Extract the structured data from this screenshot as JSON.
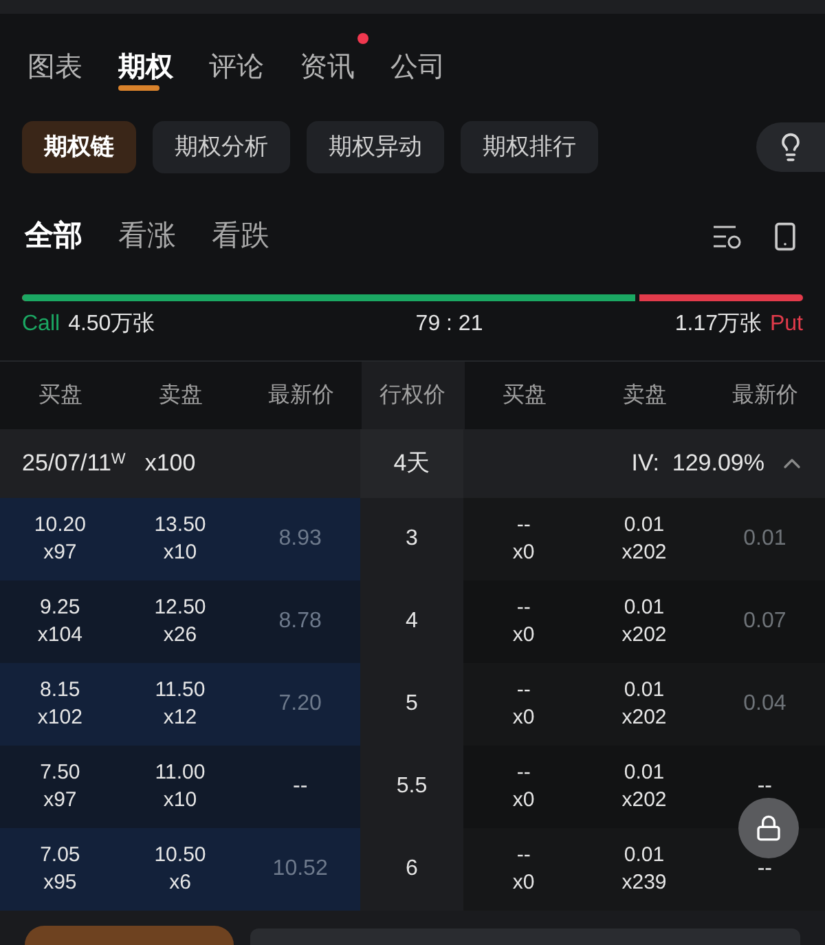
{
  "main_tabs": [
    {
      "label": "图表",
      "selected": false,
      "dot": false
    },
    {
      "label": "期权",
      "selected": true,
      "dot": false
    },
    {
      "label": "评论",
      "selected": false,
      "dot": false
    },
    {
      "label": "资讯",
      "selected": false,
      "dot": true
    },
    {
      "label": "公司",
      "selected": false,
      "dot": false
    }
  ],
  "sub_tabs": [
    {
      "label": "期权链",
      "selected": true
    },
    {
      "label": "期权分析",
      "selected": false
    },
    {
      "label": "期权异动",
      "selected": false
    },
    {
      "label": "期权排行",
      "selected": false
    }
  ],
  "filter_tabs": [
    {
      "label": "全部",
      "selected": true
    },
    {
      "label": "看涨",
      "selected": false
    },
    {
      "label": "看跌",
      "selected": false
    }
  ],
  "ratio": {
    "level": 0.79,
    "call_label": "Call",
    "call_volume": "4.50万张",
    "ratio_text": "79 : 21",
    "put_volume": "1.17万张",
    "put_label": "Put"
  },
  "columns": [
    "买盘",
    "卖盘",
    "最新价",
    "行权价",
    "买盘",
    "卖盘",
    "最新价"
  ],
  "expiry": {
    "date": "25/07/11",
    "date_mark": "W",
    "multiplier": "x100",
    "days": "4天",
    "iv": "IV:  129.09%",
    "expanded": true
  },
  "rows": [
    {
      "call_bid": "10.20",
      "call_bid_size": "x97",
      "call_ask": "13.50",
      "call_ask_size": "x10",
      "call_last": "8.93",
      "call_last_dim": true,
      "strike": "3",
      "put_bid": "--",
      "put_bid_size": "x0",
      "put_ask": "0.01",
      "put_ask_size": "x202",
      "put_last": "0.01",
      "put_last_dim": true
    },
    {
      "call_bid": "9.25",
      "call_bid_size": "x104",
      "call_ask": "12.50",
      "call_ask_size": "x26",
      "call_last": "8.78",
      "call_last_dim": true,
      "strike": "4",
      "put_bid": "--",
      "put_bid_size": "x0",
      "put_ask": "0.01",
      "put_ask_size": "x202",
      "put_last": "0.07",
      "put_last_dim": true
    },
    {
      "call_bid": "8.15",
      "call_bid_size": "x102",
      "call_ask": "11.50",
      "call_ask_size": "x12",
      "call_last": "7.20",
      "call_last_dim": true,
      "strike": "5",
      "put_bid": "--",
      "put_bid_size": "x0",
      "put_ask": "0.01",
      "put_ask_size": "x202",
      "put_last": "0.04",
      "put_last_dim": true
    },
    {
      "call_bid": "7.50",
      "call_bid_size": "x97",
      "call_ask": "11.00",
      "call_ask_size": "x10",
      "call_last": "--",
      "call_last_dim": false,
      "strike": "5.5",
      "put_bid": "--",
      "put_bid_size": "x0",
      "put_ask": "0.01",
      "put_ask_size": "x202",
      "put_last": "--",
      "put_last_dim": false
    },
    {
      "call_bid": "7.05",
      "call_bid_size": "x95",
      "call_ask": "10.50",
      "call_ask_size": "x6",
      "call_last": "10.52",
      "call_last_dim": true,
      "strike": "6",
      "put_bid": "--",
      "put_bid_size": "x0",
      "put_ask": "0.01",
      "put_ask_size": "x239",
      "put_last": "--",
      "put_last_dim": false
    }
  ]
}
